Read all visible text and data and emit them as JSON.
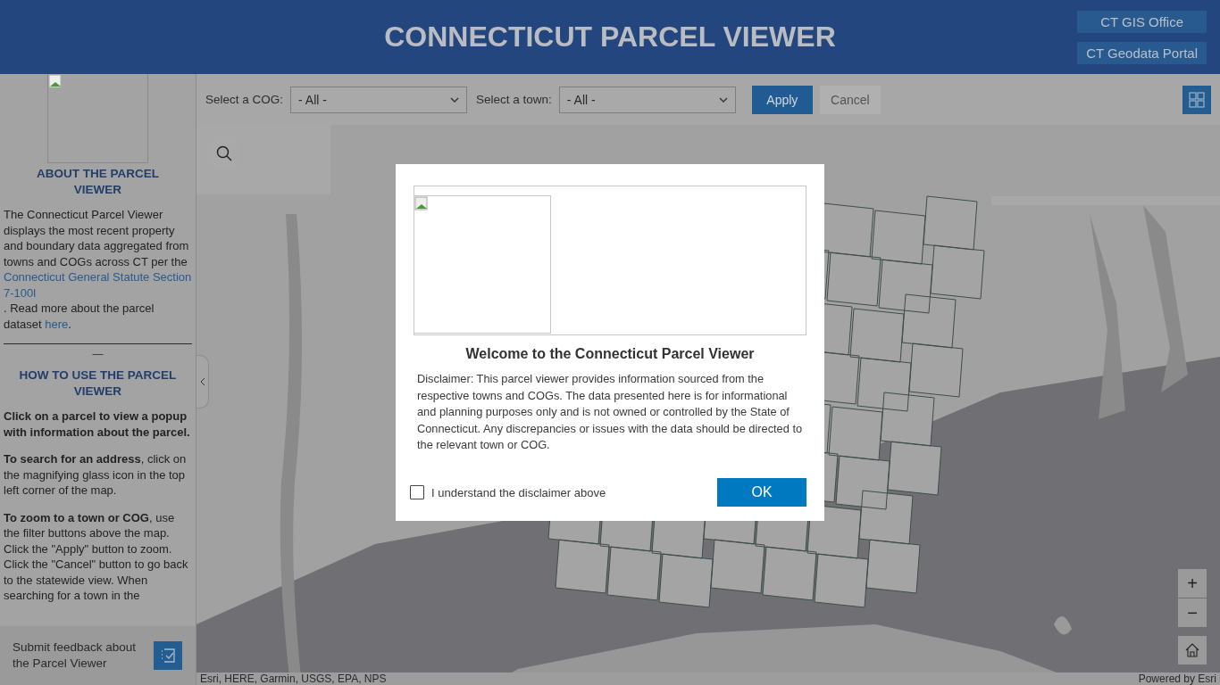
{
  "header": {
    "title": "CONNECTICUT PARCEL VIEWER",
    "links": [
      {
        "label": "CT GIS Office"
      },
      {
        "label": "CT Geodata Portal"
      }
    ]
  },
  "sidebar": {
    "logo": {
      "kind": "broken-image"
    },
    "sections": [
      {
        "heading": "ABOUT THE PARCEL VIEWER",
        "paragraphs": [
          [
            {
              "kind": "text",
              "text": "The Connecticut Parcel Viewer displays the most recent property and boundary data aggregated from towns and COGs across CT per the "
            },
            {
              "kind": "link",
              "text": "Connecticut General Statute Section 7-100l"
            },
            {
              "kind": "text",
              "text": ". Read more about the parcel dataset "
            },
            {
              "kind": "link",
              "text": "here"
            },
            {
              "kind": "text",
              "text": "."
            }
          ]
        ]
      },
      {
        "divider": "—",
        "heading": "HOW TO USE THE PARCEL VIEWER",
        "paragraphs": [
          [
            {
              "kind": "bold",
              "text": "Click on a parcel to view a popup with information about the parcel."
            }
          ],
          [
            {
              "kind": "text",
              "text": "**To search for an address**, click on the magnifying glass icon in the top left corner of the map."
            }
          ],
          [
            {
              "kind": "text",
              "text": "**To zoom to a town or COG**, use the filter buttons above the map. Click the \"Apply\" button to zoom. Click the \"Cancel\" button to go back to the statewide view. When searching for a town in the"
            }
          ]
        ]
      }
    ],
    "feedback": {
      "label": "Submit feedback about the Parcel Viewer"
    }
  },
  "filters": [
    {
      "label": "Select a COG:",
      "value": "- All -"
    },
    {
      "label": "Select a town:",
      "value": "- All -"
    }
  ],
  "actions": [
    {
      "label": "Apply",
      "disabled": false
    },
    {
      "label": "Cancel",
      "disabled": true
    }
  ],
  "map": {
    "kind": "picture",
    "attribution": "Esri, HERE, Garmin, USGS, EPA, NPS",
    "powered_by": "Powered by Esri",
    "zoom_in": "+",
    "zoom_out": "−"
  },
  "dialog": {
    "title": "Welcome to the Connecticut Parcel Viewer",
    "body": "Disclaimer: This parcel viewer provides information sourced from the respective towns and COGs. The data presented here is for informational and planning purposes only and is not owned or controlled by the State of Connecticut. Any discrepancies or issues with the data should be directed to the relevant town or COG.",
    "checkbox": {
      "label": "I understand the disclaimer above",
      "checked": false
    },
    "button": "OK"
  }
}
